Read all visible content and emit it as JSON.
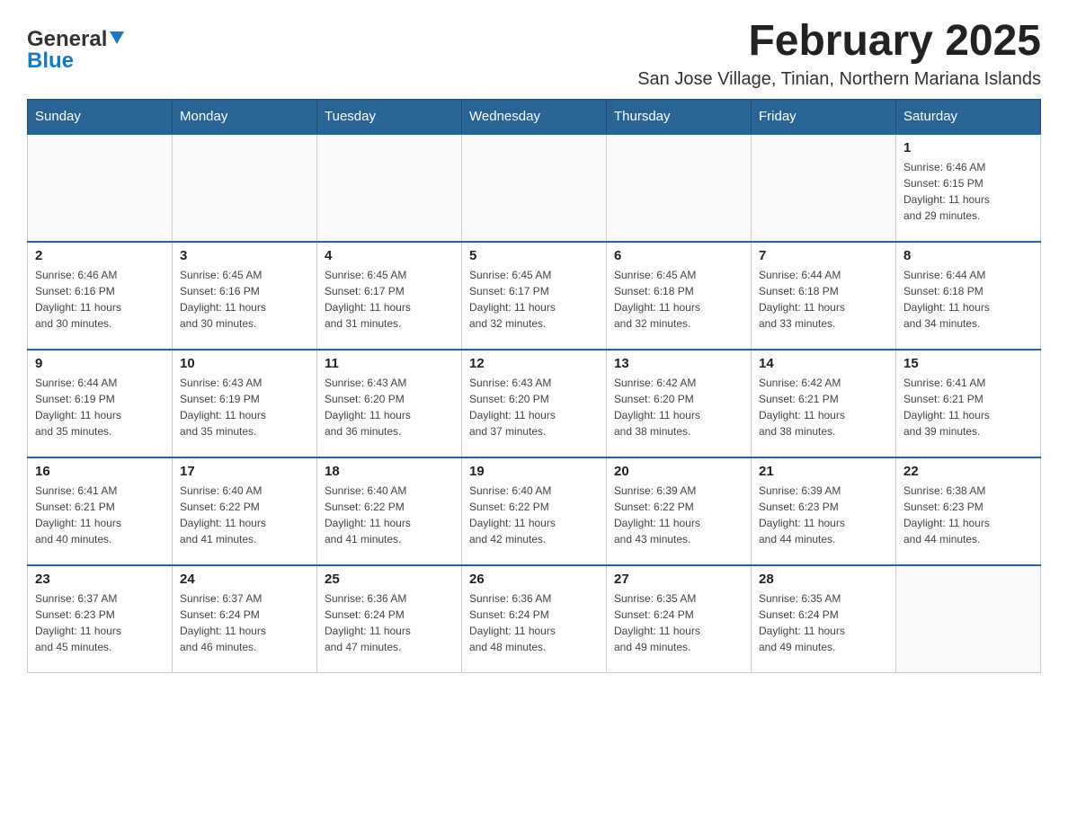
{
  "logo": {
    "general": "General",
    "blue": "Blue"
  },
  "title": "February 2025",
  "location": "San Jose Village, Tinian, Northern Mariana Islands",
  "days_of_week": [
    "Sunday",
    "Monday",
    "Tuesday",
    "Wednesday",
    "Thursday",
    "Friday",
    "Saturday"
  ],
  "weeks": [
    [
      {
        "day": "",
        "info": ""
      },
      {
        "day": "",
        "info": ""
      },
      {
        "day": "",
        "info": ""
      },
      {
        "day": "",
        "info": ""
      },
      {
        "day": "",
        "info": ""
      },
      {
        "day": "",
        "info": ""
      },
      {
        "day": "1",
        "info": "Sunrise: 6:46 AM\nSunset: 6:15 PM\nDaylight: 11 hours\nand 29 minutes."
      }
    ],
    [
      {
        "day": "2",
        "info": "Sunrise: 6:46 AM\nSunset: 6:16 PM\nDaylight: 11 hours\nand 30 minutes."
      },
      {
        "day": "3",
        "info": "Sunrise: 6:45 AM\nSunset: 6:16 PM\nDaylight: 11 hours\nand 30 minutes."
      },
      {
        "day": "4",
        "info": "Sunrise: 6:45 AM\nSunset: 6:17 PM\nDaylight: 11 hours\nand 31 minutes."
      },
      {
        "day": "5",
        "info": "Sunrise: 6:45 AM\nSunset: 6:17 PM\nDaylight: 11 hours\nand 32 minutes."
      },
      {
        "day": "6",
        "info": "Sunrise: 6:45 AM\nSunset: 6:18 PM\nDaylight: 11 hours\nand 32 minutes."
      },
      {
        "day": "7",
        "info": "Sunrise: 6:44 AM\nSunset: 6:18 PM\nDaylight: 11 hours\nand 33 minutes."
      },
      {
        "day": "8",
        "info": "Sunrise: 6:44 AM\nSunset: 6:18 PM\nDaylight: 11 hours\nand 34 minutes."
      }
    ],
    [
      {
        "day": "9",
        "info": "Sunrise: 6:44 AM\nSunset: 6:19 PM\nDaylight: 11 hours\nand 35 minutes."
      },
      {
        "day": "10",
        "info": "Sunrise: 6:43 AM\nSunset: 6:19 PM\nDaylight: 11 hours\nand 35 minutes."
      },
      {
        "day": "11",
        "info": "Sunrise: 6:43 AM\nSunset: 6:20 PM\nDaylight: 11 hours\nand 36 minutes."
      },
      {
        "day": "12",
        "info": "Sunrise: 6:43 AM\nSunset: 6:20 PM\nDaylight: 11 hours\nand 37 minutes."
      },
      {
        "day": "13",
        "info": "Sunrise: 6:42 AM\nSunset: 6:20 PM\nDaylight: 11 hours\nand 38 minutes."
      },
      {
        "day": "14",
        "info": "Sunrise: 6:42 AM\nSunset: 6:21 PM\nDaylight: 11 hours\nand 38 minutes."
      },
      {
        "day": "15",
        "info": "Sunrise: 6:41 AM\nSunset: 6:21 PM\nDaylight: 11 hours\nand 39 minutes."
      }
    ],
    [
      {
        "day": "16",
        "info": "Sunrise: 6:41 AM\nSunset: 6:21 PM\nDaylight: 11 hours\nand 40 minutes."
      },
      {
        "day": "17",
        "info": "Sunrise: 6:40 AM\nSunset: 6:22 PM\nDaylight: 11 hours\nand 41 minutes."
      },
      {
        "day": "18",
        "info": "Sunrise: 6:40 AM\nSunset: 6:22 PM\nDaylight: 11 hours\nand 41 minutes."
      },
      {
        "day": "19",
        "info": "Sunrise: 6:40 AM\nSunset: 6:22 PM\nDaylight: 11 hours\nand 42 minutes."
      },
      {
        "day": "20",
        "info": "Sunrise: 6:39 AM\nSunset: 6:22 PM\nDaylight: 11 hours\nand 43 minutes."
      },
      {
        "day": "21",
        "info": "Sunrise: 6:39 AM\nSunset: 6:23 PM\nDaylight: 11 hours\nand 44 minutes."
      },
      {
        "day": "22",
        "info": "Sunrise: 6:38 AM\nSunset: 6:23 PM\nDaylight: 11 hours\nand 44 minutes."
      }
    ],
    [
      {
        "day": "23",
        "info": "Sunrise: 6:37 AM\nSunset: 6:23 PM\nDaylight: 11 hours\nand 45 minutes."
      },
      {
        "day": "24",
        "info": "Sunrise: 6:37 AM\nSunset: 6:24 PM\nDaylight: 11 hours\nand 46 minutes."
      },
      {
        "day": "25",
        "info": "Sunrise: 6:36 AM\nSunset: 6:24 PM\nDaylight: 11 hours\nand 47 minutes."
      },
      {
        "day": "26",
        "info": "Sunrise: 6:36 AM\nSunset: 6:24 PM\nDaylight: 11 hours\nand 48 minutes."
      },
      {
        "day": "27",
        "info": "Sunrise: 6:35 AM\nSunset: 6:24 PM\nDaylight: 11 hours\nand 49 minutes."
      },
      {
        "day": "28",
        "info": "Sunrise: 6:35 AM\nSunset: 6:24 PM\nDaylight: 11 hours\nand 49 minutes."
      },
      {
        "day": "",
        "info": ""
      }
    ]
  ]
}
